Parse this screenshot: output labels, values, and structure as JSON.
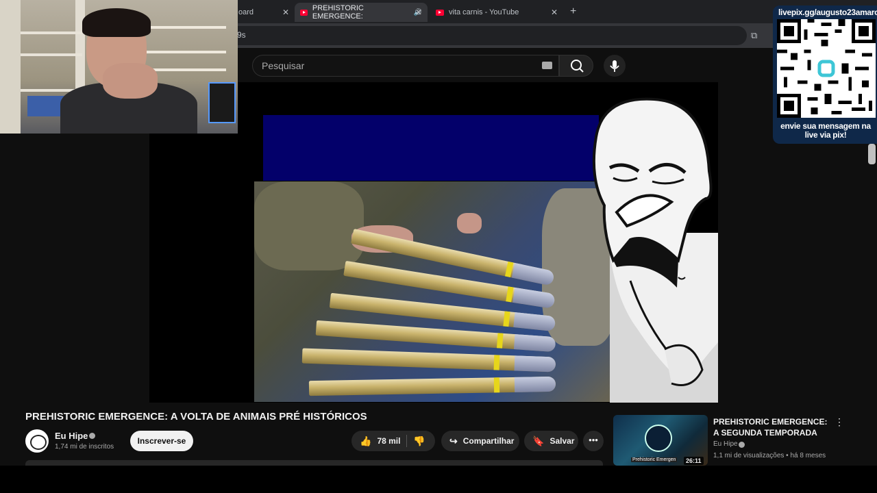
{
  "browser": {
    "tabs": [
      {
        "label": "oard",
        "close": "✕"
      },
      {
        "label": "PREHISTORIC EMERGENCE:",
        "close": "✕"
      },
      {
        "label": "vita carnis - YouTube",
        "close": "✕"
      }
    ],
    "new_tab": "+",
    "address_fragment": "9s"
  },
  "youtube": {
    "search_placeholder": "Pesquisar"
  },
  "overlay": {
    "qr_url": "livepix.gg/augusto23amaro",
    "qr_message": "envie sua mensagem na live via pix!"
  },
  "video": {
    "title": "PREHISTORIC EMERGENCE: A VOLTA DE ANIMAIS PRÉ HISTÓRICOS",
    "channel": "Eu Hipe",
    "subscribers": "1,74 mi de inscritos",
    "subscribe_label": "Inscrever-se",
    "likes": "78 mil",
    "share_label": "Compartilhar",
    "save_label": "Salvar"
  },
  "related": {
    "title": "PREHISTORIC EMERGENCE: A SEGUNDA TEMPORADA",
    "channel": "Eu Hipe",
    "meta": "1,1 mi de visualizações • há 8 meses",
    "duration": "26:11",
    "thumb_caption": "Prehistoric Emergen"
  },
  "colors": {
    "youtube_red": "#ff0033",
    "overlay_blue": "#0f2849",
    "video_blue_bar": "#03006a"
  }
}
